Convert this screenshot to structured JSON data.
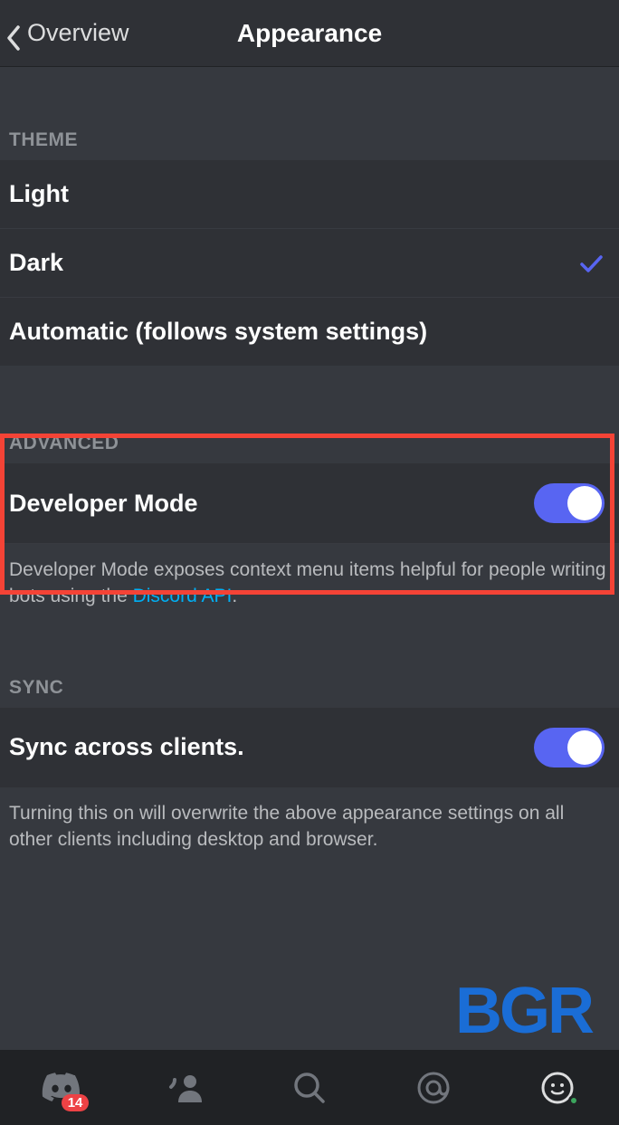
{
  "header": {
    "back_label": "Overview",
    "title": "Appearance"
  },
  "sections": {
    "theme": {
      "header": "THEME",
      "options": [
        {
          "label": "Light",
          "selected": false
        },
        {
          "label": "Dark",
          "selected": true
        },
        {
          "label": "Automatic (follows system settings)",
          "selected": false
        }
      ]
    },
    "advanced": {
      "header": "ADVANCED",
      "developer_mode_label": "Developer Mode",
      "developer_mode_on": true,
      "desc_prefix": "Developer Mode exposes context menu items helpful for people writing bots using the ",
      "desc_link_text": "Discord API",
      "desc_suffix": "."
    },
    "sync": {
      "header": "SYNC",
      "sync_label": "Sync across clients.",
      "sync_on": true,
      "desc": "Turning this on will overwrite the above appearance settings on all other clients including desktop and browser."
    }
  },
  "tabbar": {
    "badge_count": "14"
  },
  "watermark": "BGR",
  "colors": {
    "accent": "#5865f2",
    "highlight": "#f44336",
    "link": "#00aff4",
    "badge": "#ed4245",
    "status_online": "#3ba55d"
  }
}
